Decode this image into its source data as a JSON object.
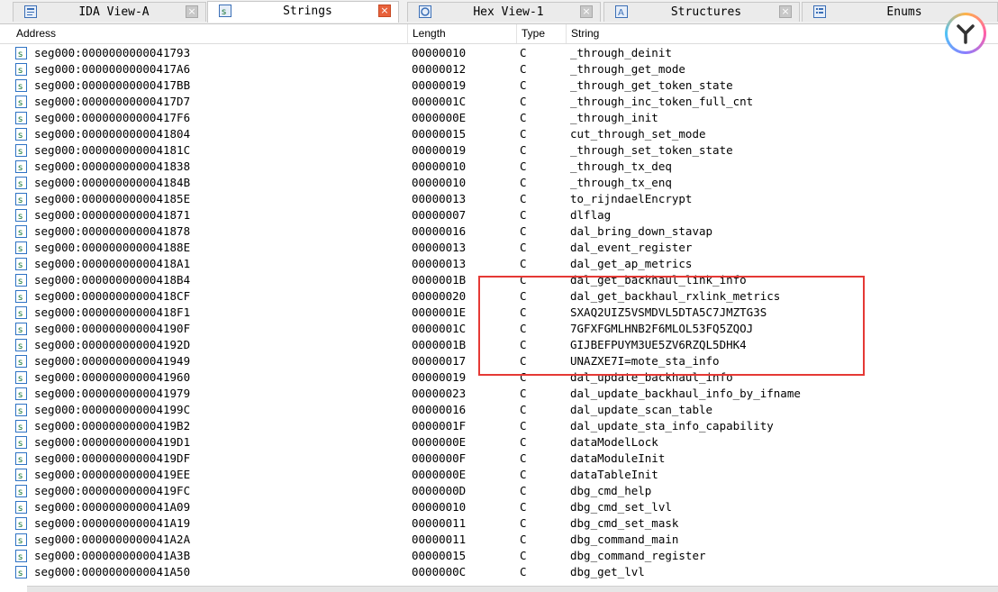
{
  "tabs": [
    {
      "label": "IDA View-A",
      "icon": "ida-view-icon",
      "active": false
    },
    {
      "label": "Strings",
      "icon": "strings-icon",
      "active": true
    },
    {
      "label": "Hex View-1",
      "icon": "hex-view-icon",
      "active": false
    },
    {
      "label": "Structures",
      "icon": "structures-icon",
      "active": false
    },
    {
      "label": "Enums",
      "icon": "enums-icon",
      "active": false
    }
  ],
  "columns": {
    "address": "Address",
    "length": "Length",
    "type": "Type",
    "string": "String"
  },
  "rows": [
    {
      "address": "seg000:0000000000041793",
      "length": "00000010",
      "type": "C",
      "string": "_through_deinit"
    },
    {
      "address": "seg000:00000000000417A6",
      "length": "00000012",
      "type": "C",
      "string": "_through_get_mode"
    },
    {
      "address": "seg000:00000000000417BB",
      "length": "00000019",
      "type": "C",
      "string": "_through_get_token_state"
    },
    {
      "address": "seg000:00000000000417D7",
      "length": "0000001C",
      "type": "C",
      "string": "_through_inc_token_full_cnt"
    },
    {
      "address": "seg000:00000000000417F6",
      "length": "0000000E",
      "type": "C",
      "string": "_through_init"
    },
    {
      "address": "seg000:0000000000041804",
      "length": "00000015",
      "type": "C",
      "string": "cut_through_set_mode"
    },
    {
      "address": "seg000:000000000004181C",
      "length": "00000019",
      "type": "C",
      "string": "_through_set_token_state"
    },
    {
      "address": "seg000:0000000000041838",
      "length": "00000010",
      "type": "C",
      "string": "_through_tx_deq"
    },
    {
      "address": "seg000:000000000004184B",
      "length": "00000010",
      "type": "C",
      "string": "_through_tx_enq"
    },
    {
      "address": "seg000:000000000004185E",
      "length": "00000013",
      "type": "C",
      "string": "to_rijndaelEncrypt"
    },
    {
      "address": "seg000:0000000000041871",
      "length": "00000007",
      "type": "C",
      "string": "dlflag"
    },
    {
      "address": "seg000:0000000000041878",
      "length": "00000016",
      "type": "C",
      "string": "dal_bring_down_stavap"
    },
    {
      "address": "seg000:000000000004188E",
      "length": "00000013",
      "type": "C",
      "string": "dal_event_register"
    },
    {
      "address": "seg000:00000000000418A1",
      "length": "00000013",
      "type": "C",
      "string": "dal_get_ap_metrics"
    },
    {
      "address": "seg000:00000000000418B4",
      "length": "0000001B",
      "type": "C",
      "string": "dal_get_backhaul_link_info"
    },
    {
      "address": "seg000:00000000000418CF",
      "length": "00000020",
      "type": "C",
      "string": "dal_get_backhaul_rxlink_metrics"
    },
    {
      "address": "seg000:00000000000418F1",
      "length": "0000001E",
      "type": "C",
      "string": "SXAQ2UIZ5VSMDVL5DTA5C7JMZTG3S"
    },
    {
      "address": "seg000:000000000004190F",
      "length": "0000001C",
      "type": "C",
      "string": "7GFXFGMLHNB2F6MLOL53FQ5ZQOJ"
    },
    {
      "address": "seg000:000000000004192D",
      "length": "0000001B",
      "type": "C",
      "string": "GIJBEFPUYM3UE5ZV6RZQL5DHK4"
    },
    {
      "address": "seg000:0000000000041949",
      "length": "00000017",
      "type": "C",
      "string": "UNAZXE7I=mote_sta_info"
    },
    {
      "address": "seg000:0000000000041960",
      "length": "00000019",
      "type": "C",
      "string": "dal_update_backhaul_info"
    },
    {
      "address": "seg000:0000000000041979",
      "length": "00000023",
      "type": "C",
      "string": "dal_update_backhaul_info_by_ifname"
    },
    {
      "address": "seg000:000000000004199C",
      "length": "00000016",
      "type": "C",
      "string": "dal_update_scan_table"
    },
    {
      "address": "seg000:00000000000419B2",
      "length": "0000001F",
      "type": "C",
      "string": "dal_update_sta_info_capability"
    },
    {
      "address": "seg000:00000000000419D1",
      "length": "0000000E",
      "type": "C",
      "string": "dataModelLock"
    },
    {
      "address": "seg000:00000000000419DF",
      "length": "0000000F",
      "type": "C",
      "string": "dataModuleInit"
    },
    {
      "address": "seg000:00000000000419EE",
      "length": "0000000E",
      "type": "C",
      "string": "dataTableInit"
    },
    {
      "address": "seg000:00000000000419FC",
      "length": "0000000D",
      "type": "C",
      "string": "dbg_cmd_help"
    },
    {
      "address": "seg000:0000000000041A09",
      "length": "00000010",
      "type": "C",
      "string": "dbg_cmd_set_lvl"
    },
    {
      "address": "seg000:0000000000041A19",
      "length": "00000011",
      "type": "C",
      "string": "dbg_cmd_set_mask"
    },
    {
      "address": "seg000:0000000000041A2A",
      "length": "00000011",
      "type": "C",
      "string": "dbg_command_main"
    },
    {
      "address": "seg000:0000000000041A3B",
      "length": "00000015",
      "type": "C",
      "string": "dbg_command_register"
    },
    {
      "address": "seg000:0000000000041A50",
      "length": "0000000C",
      "type": "C",
      "string": "dbg_get_lvl"
    }
  ],
  "colors": {
    "highlight": "#e53935",
    "active_tab_close": "#e8623c",
    "row_icon": "#2f73c4"
  },
  "icons": {
    "row": "string-entry-icon",
    "logo": "app-logo-icon"
  }
}
